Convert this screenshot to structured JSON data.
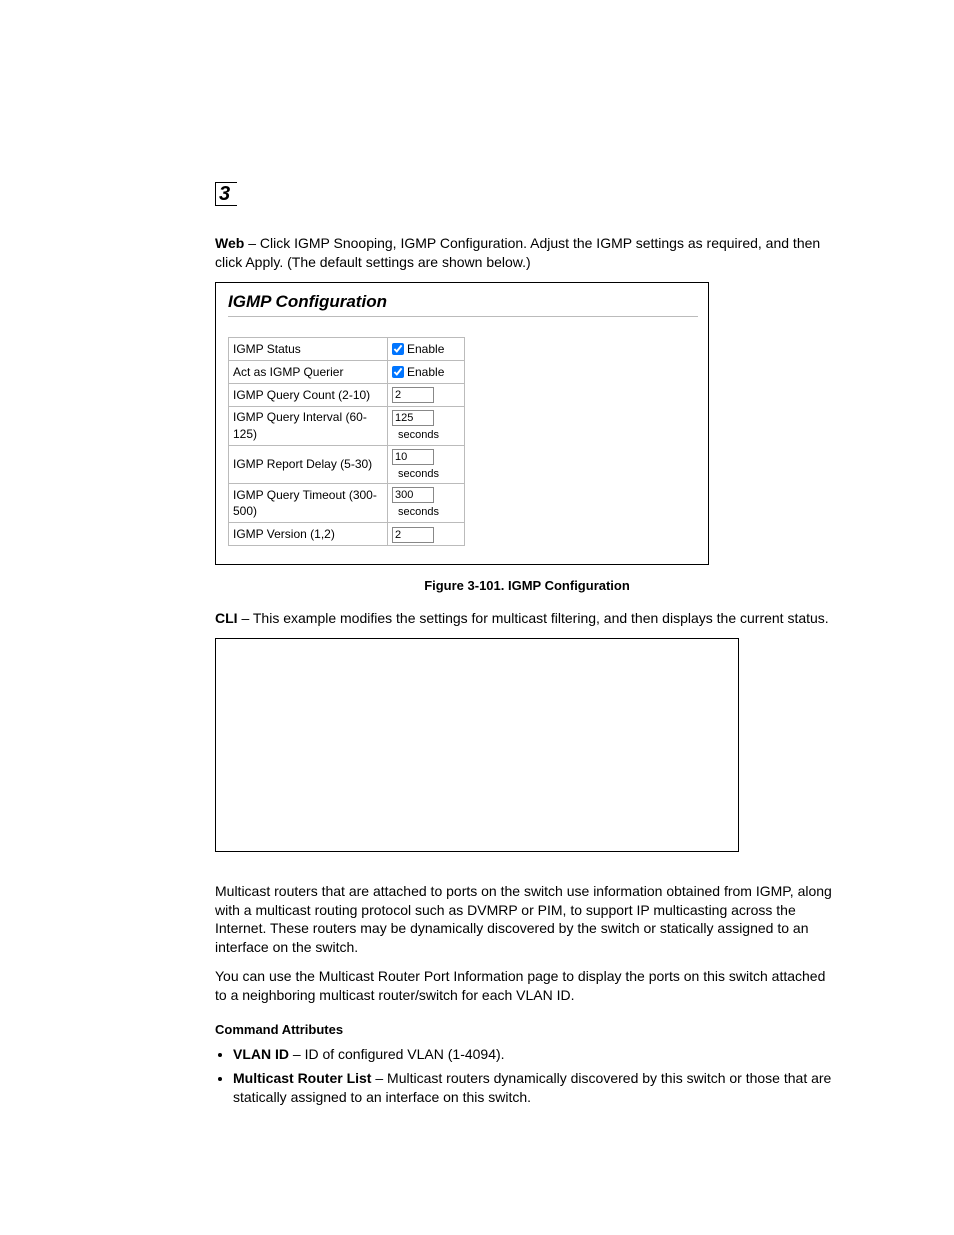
{
  "chapter_number": "3",
  "intro": {
    "web_label": "Web",
    "web_text": " – Click IGMP Snooping, IGMP Configuration. Adjust the IGMP settings as required, and then click Apply. (The default settings are shown below.)"
  },
  "screenshot": {
    "title": "IGMP Configuration",
    "rows": {
      "status": {
        "label": "IGMP Status",
        "enable": "Enable"
      },
      "querier": {
        "label": "Act as IGMP Querier",
        "enable": "Enable"
      },
      "query_count": {
        "label": "IGMP Query Count (2-10)",
        "value": "2"
      },
      "query_interval": {
        "label": "IGMP Query Interval (60-125)",
        "value": "125",
        "unit": "seconds"
      },
      "report_delay": {
        "label": "IGMP Report Delay (5-30)",
        "value": "10",
        "unit": "seconds"
      },
      "query_timeout": {
        "label": "IGMP Query Timeout (300-500)",
        "value": "300",
        "unit": "seconds"
      },
      "version": {
        "label": "IGMP Version (1,2)",
        "value": "2"
      }
    }
  },
  "figure_caption": "Figure 3-101.  IGMP Configuration",
  "cli": {
    "label": "CLI",
    "text": " – This example modifies the settings for multicast filtering, and then displays the current status."
  },
  "para1": "Multicast routers that are attached to ports on the switch use information obtained from IGMP, along with a multicast routing protocol such as DVMRP or PIM, to support IP multicasting across the Internet. These routers may be dynamically discovered by the switch or statically assigned to an interface on the switch.",
  "para2": "You can use the Multicast Router Port Information page to display the ports on this switch attached to a neighboring multicast router/switch for each VLAN ID.",
  "command_attributes_heading": "Command Attributes",
  "attrs": {
    "vlan": {
      "name": "VLAN ID",
      "desc": " – ID of configured VLAN (1-4094)."
    },
    "mrl": {
      "name": "Multicast Router List",
      "desc": " – Multicast routers dynamically discovered by this switch or those that are statically assigned to an interface on this switch."
    }
  }
}
